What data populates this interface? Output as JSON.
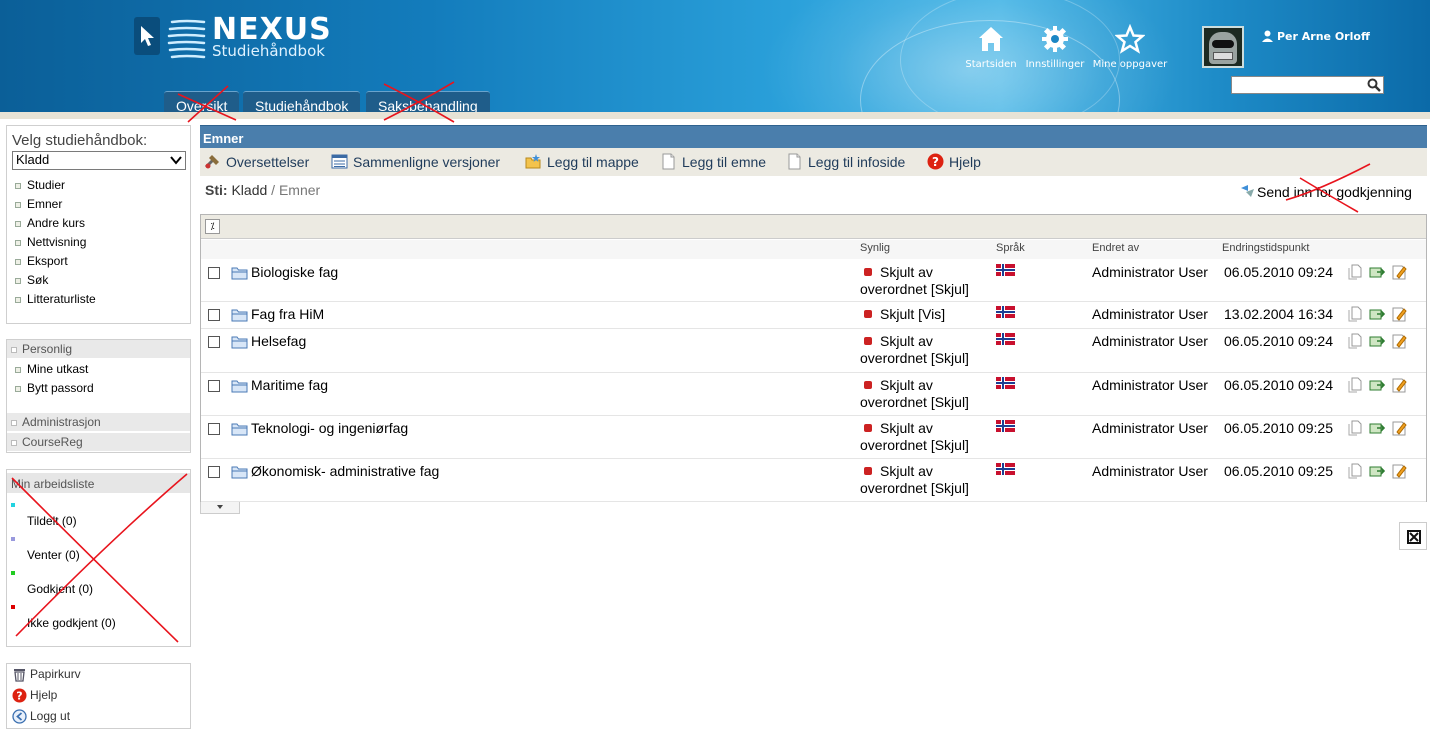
{
  "header": {
    "logo_title": "NEXUS",
    "logo_subtitle": "Studiehåndbok",
    "icons": [
      {
        "label": "Startsiden",
        "icon": "home-icon"
      },
      {
        "label": "Innstillinger",
        "icon": "gear-icon"
      },
      {
        "label": "Mine oppgaver",
        "icon": "star-icon"
      }
    ],
    "user_name": "Per Arne Orloff",
    "search_placeholder": ""
  },
  "tabs": [
    "Oversikt",
    "Studiehåndbok",
    "Saksbehandling"
  ],
  "sidebar": {
    "caption": "Velg studiehåndbok:",
    "select_value": "Kladd",
    "items": [
      "Studier",
      "Emner",
      "Andre kurs",
      "Nettvisning",
      "Eksport",
      "Søk",
      "Litteraturliste"
    ],
    "personal_header": "Personlig",
    "personal_items": [
      "Mine utkast",
      "Bytt passord"
    ],
    "admin_header": "Administrasjon",
    "coursereg_header": "CourseReg",
    "worklist_header": "Min arbeidsliste",
    "worklist": [
      {
        "label": "Tildelt (0)",
        "color": "#22d3e0"
      },
      {
        "label": "Venter (0)",
        "color": "#9999dd"
      },
      {
        "label": "Godkjent (0)",
        "color": "#22cc22"
      },
      {
        "label": "Ikke godkjent (0)",
        "color": "#dd0000"
      }
    ],
    "bottom_items": [
      {
        "label": "Papirkurv",
        "icon": "trash-icon"
      },
      {
        "label": "Hjelp",
        "icon": "help-icon"
      },
      {
        "label": "Logg ut",
        "icon": "logout-icon"
      }
    ]
  },
  "main": {
    "title": "Emner",
    "toolbar": [
      {
        "label": "Oversettelser",
        "icon": "translate-icon"
      },
      {
        "label": "Sammenligne versjoner",
        "icon": "compare-icon"
      },
      {
        "label": "Legg til mappe",
        "icon": "add-folder-icon"
      },
      {
        "label": "Legg til emne",
        "icon": "add-document-icon"
      },
      {
        "label": "Legg til infoside",
        "icon": "add-infopage-icon"
      },
      {
        "label": "Hjelp",
        "icon": "help-icon"
      }
    ],
    "path_label": "Sti:",
    "path_root": "Kladd",
    "path_sep": " / ",
    "path_current": "Emner",
    "send_inn": "Send inn for godkjenning",
    "columns": [
      "Synlig",
      "Språk",
      "Endret av",
      "Endringstidspunkt"
    ],
    "rows": [
      {
        "name": "Biologiske fag",
        "vis1": "Skjult av",
        "vis2": "overordnet [Skjul]",
        "by": "Administrator User",
        "date": "06.05.2010 09:24"
      },
      {
        "name": "Fag fra HiM",
        "vis1": "Skjult [Vis]",
        "vis2": "",
        "by": "Administrator User",
        "date": "13.02.2004 16:34"
      },
      {
        "name": "Helsefag",
        "vis1": "Skjult av",
        "vis2": "overordnet [Skjul]",
        "by": "Administrator User",
        "date": "06.05.2010 09:24"
      },
      {
        "name": "Maritime fag",
        "vis1": "Skjult av",
        "vis2": "overordnet [Skjul]",
        "by": "Administrator User",
        "date": "06.05.2010 09:24"
      },
      {
        "name": "Teknologi- og ingeniørfag",
        "vis1": "Skjult av",
        "vis2": "overordnet [Skjul]",
        "by": "Administrator User",
        "date": "06.05.2010 09:25"
      },
      {
        "name": "Økonomisk- administrative fag",
        "vis1": "Skjult av",
        "vis2": "overordnet [Skjul]",
        "by": "Administrator User",
        "date": "06.05.2010 09:25"
      }
    ]
  }
}
